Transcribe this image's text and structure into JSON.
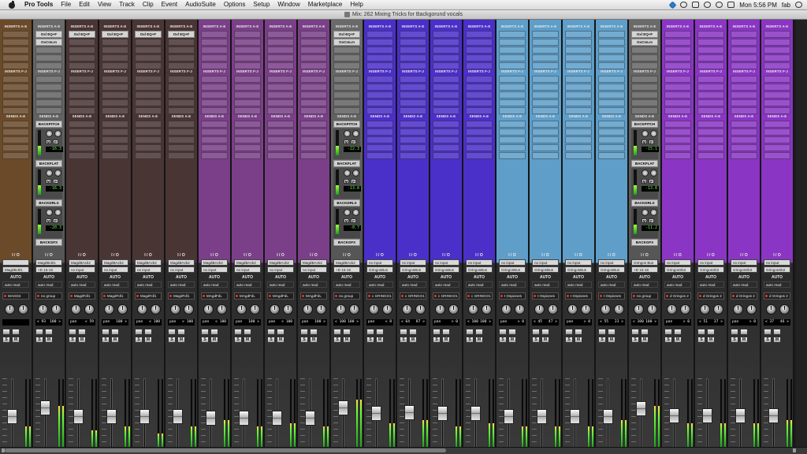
{
  "menubar": {
    "app": "Pro Tools",
    "items": [
      "File",
      "Edit",
      "View",
      "Track",
      "Clip",
      "Event",
      "AudioSuite",
      "Options",
      "Setup",
      "Window",
      "Marketplace",
      "Help"
    ],
    "clock": "Mon 5:56 PM",
    "user": "fab"
  },
  "window": {
    "title": "Mix: 262 Mixing Tricks for Backgorund vocals"
  },
  "labels": {
    "inserts_ae": "INSERTS A-E",
    "inserts_fj": "INSERTS F-J",
    "sends_ae": "SENDS A-E",
    "io": "I / O",
    "auto": "AUTO",
    "m": "M",
    "p": "P",
    "s": "S"
  },
  "strips": [
    {
      "name": "",
      "color": "#6b4a2a",
      "type": "audio",
      "output": "MagdBckl1",
      "mono": false,
      "group": "MAGD4",
      "pan_l": "",
      "pan_r": "",
      "fader": 0.45,
      "meter": 0.3
    },
    {
      "name": "",
      "color": "#5e5e5e",
      "type": "aux",
      "inserts": [
        "Oxl EQ+F",
        "OxCmLm"
      ],
      "sends": [
        {
          "name": "BACKPITCH",
          "val": "-16.3"
        },
        {
          "name": "BACKFLAT",
          "val": "-16.3"
        },
        {
          "name": "BACKDRLS",
          "val": "-20.3"
        },
        {
          "name": "BACKGFX",
          "val": ""
        }
      ],
      "input": "MagdBckl1",
      "output": "+D 15-16",
      "group": "no group",
      "pan_l": "< 93",
      "pan_r": "100 >",
      "fader": 0.6,
      "meter": 0.6
    },
    {
      "name": "",
      "color": "#4a3535",
      "type": "audio",
      "inserts": [
        "Oxl EQ+F"
      ],
      "input": "MagdBAck2",
      "output": "no input",
      "group": "MagdFdl1",
      "pan_l": "pan",
      "pan_r": "< 59",
      "fader": 0.45,
      "meter": 0.25
    },
    {
      "name": "",
      "color": "#4a3535",
      "type": "audio",
      "inserts": [
        "Oxl EQ+F"
      ],
      "input": "MagdBAck2",
      "output": "no input",
      "group": "MagdFdl1",
      "pan_l": "pan",
      "pan_r": "100 >",
      "fader": 0.45,
      "meter": 0.3
    },
    {
      "name": "",
      "color": "#4a3535",
      "type": "audio",
      "inserts": [
        "Oxl EQ+F"
      ],
      "input": "MagdBAck2",
      "output": "no input",
      "group": "MagdFdl1",
      "pan_l": "pan",
      "pan_r": "< 100",
      "fader": 0.45,
      "meter": 0.2
    },
    {
      "name": "",
      "color": "#4a3535",
      "type": "audio",
      "inserts": [
        "Oxl EQ+F"
      ],
      "input": "MagdBAck2",
      "output": "no input",
      "group": "MagdFdl1",
      "pan_l": "pan",
      "pan_r": "> 100",
      "fader": 0.45,
      "meter": 0.3
    },
    {
      "name": "",
      "color": "#7a3f88",
      "type": "audio",
      "inserts": [],
      "input": "MagdBAck2",
      "output": "no input",
      "group": "MAgdFdL",
      "pan_l": "pan",
      "pan_r": "< 100",
      "fader": 0.42,
      "meter": 0.4
    },
    {
      "name": "",
      "color": "#7a3f88",
      "type": "audio",
      "inserts": [],
      "input": "MagdBAck2",
      "output": "no input",
      "group": "MAgdFdL",
      "pan_l": "pan",
      "pan_r": "100 >",
      "fader": 0.42,
      "meter": 0.3
    },
    {
      "name": "",
      "color": "#7a3f88",
      "type": "audio",
      "inserts": [],
      "input": "MagdBAck2",
      "output": "no input",
      "group": "MAgdFdL",
      "pan_l": "pan",
      "pan_r": "< 100",
      "fader": 0.42,
      "meter": 0.35
    },
    {
      "name": "",
      "color": "#7a3f88",
      "type": "audio",
      "inserts": [],
      "input": "MagdBAck2",
      "output": "no input",
      "group": "MAgdFdL",
      "pan_l": "pan",
      "pan_r": "100 >",
      "fader": 0.42,
      "meter": 0.3
    },
    {
      "name": "",
      "color": "#5e5e5e",
      "type": "aux",
      "inserts": [
        "Oxl EQ+F",
        "OxCmLm"
      ],
      "sends": [
        {
          "name": "BACKPITCH",
          "val": "-22.3"
        },
        {
          "name": "BACKFLAT",
          "val": "-13.8"
        },
        {
          "name": "BACKDRLS",
          "val": "-0.7"
        },
        {
          "name": "BACKGFX",
          "val": ""
        }
      ],
      "input": "MagdBAck2",
      "output": "+D 15-16",
      "group": "no group",
      "pan_l": "< 100",
      "pan_r": "100 >",
      "fader": 0.6,
      "meter": 0.7
    },
    {
      "name": "",
      "color": "#4b2fc9",
      "type": "audio",
      "inserts": [],
      "input": "no input",
      "output": "GringosBus",
      "group": "c GRINGO1",
      "pan_l": "pan",
      "pan_r": "< 8",
      "fader": 0.5,
      "meter": 0.35
    },
    {
      "name": "",
      "color": "#4b2fc9",
      "type": "audio",
      "inserts": [],
      "input": "no input",
      "output": "GringosBus",
      "group": "c GRINGO1",
      "pan_l": "< 64",
      "pan_r": "87 >",
      "fader": 0.52,
      "meter": 0.4
    },
    {
      "name": "",
      "color": "#4b2fc9",
      "type": "audio",
      "inserts": [],
      "input": "no input",
      "output": "GringosBus",
      "group": "c GRINGO1",
      "pan_l": "pan",
      "pan_r": "> 0",
      "fader": 0.5,
      "meter": 0.3
    },
    {
      "name": "",
      "color": "#4b2fc9",
      "type": "audio",
      "inserts": [],
      "input": "no input",
      "output": "GringosBus",
      "group": "c GRINGO1",
      "pan_l": "< 100",
      "pan_r": "100 >",
      "fader": 0.5,
      "meter": 0.35
    },
    {
      "name": "",
      "color": "#5e9ec9",
      "type": "audio",
      "inserts": [],
      "input": "no input",
      "output": "GringosBus",
      "group": "t Ospiones",
      "pan_l": "pan",
      "pan_r": "> 0",
      "fader": 0.44,
      "meter": 0.3
    },
    {
      "name": "",
      "color": "#5e9ec9",
      "type": "audio",
      "inserts": [],
      "input": "no input",
      "output": "GringosBus",
      "group": "t Ospiones",
      "pan_l": "< 45",
      "pan_r": "47 >",
      "fader": 0.44,
      "meter": 0.3
    },
    {
      "name": "",
      "color": "#5e9ec9",
      "type": "audio",
      "inserts": [],
      "input": "no input",
      "output": "GringosBus",
      "group": "t Ospiones",
      "pan_l": "pan",
      "pan_r": "> 0",
      "fader": 0.44,
      "meter": 0.3
    },
    {
      "name": "",
      "color": "#5e9ec9",
      "type": "audio",
      "inserts": [],
      "input": "no input",
      "output": "GringosBus",
      "group": "t Ospiones",
      "pan_l": "< 55",
      "pan_r": "23 >",
      "fader": 0.44,
      "meter": 0.4
    },
    {
      "name": "",
      "color": "#5e5e5e",
      "type": "aux",
      "inserts": [
        "Oxl EQ+F",
        "OxCmLm"
      ],
      "sends": [
        {
          "name": "BACKPITCH",
          "val": "-15.1"
        },
        {
          "name": "BACKFLAT",
          "val": "-13.8"
        },
        {
          "name": "BACKDRLS",
          "val": "-11.2"
        },
        {
          "name": "BACKGFX",
          "val": ""
        }
      ],
      "input": "Gringos Bus",
      "output": "+D 15-16",
      "group": "no group",
      "pan_l": "< 100",
      "pan_r": "100 >",
      "fader": 0.58,
      "meter": 0.6
    },
    {
      "name": "",
      "color": "#8a35c4",
      "type": "audio",
      "inserts": [],
      "input": "no input",
      "output": "GringosSb2",
      "group": "d Gringos 2",
      "pan_l": "pan",
      "pan_r": "> 0",
      "fader": 0.46,
      "meter": 0.35
    },
    {
      "name": "",
      "color": "#8a35c4",
      "type": "audio",
      "inserts": [],
      "input": "no input",
      "output": "GringosSb2",
      "group": "d Gringos 2",
      "pan_l": "< 51",
      "pan_r": "37 >",
      "fader": 0.46,
      "meter": 0.35
    },
    {
      "name": "",
      "color": "#8a35c4",
      "type": "audio",
      "inserts": [],
      "input": "no input",
      "output": "GringosSb2",
      "group": "d Gringos 2",
      "pan_l": "pan",
      "pan_r": "> 0",
      "fader": 0.46,
      "meter": 0.35
    },
    {
      "name": "",
      "color": "#8a35c4",
      "type": "audio",
      "inserts": [],
      "input": "no input",
      "output": "GringosSb2",
      "group": "d Gringos 2",
      "pan_l": "< 37",
      "pan_r": "46 >",
      "fader": 0.46,
      "meter": 0.4
    }
  ],
  "auto_mode": "auto read",
  "status_icons": [
    "dropbox-icon",
    "wifi-icon",
    "bluetooth-icon",
    "clock-icon",
    "volume-icon",
    "search-icon"
  ]
}
